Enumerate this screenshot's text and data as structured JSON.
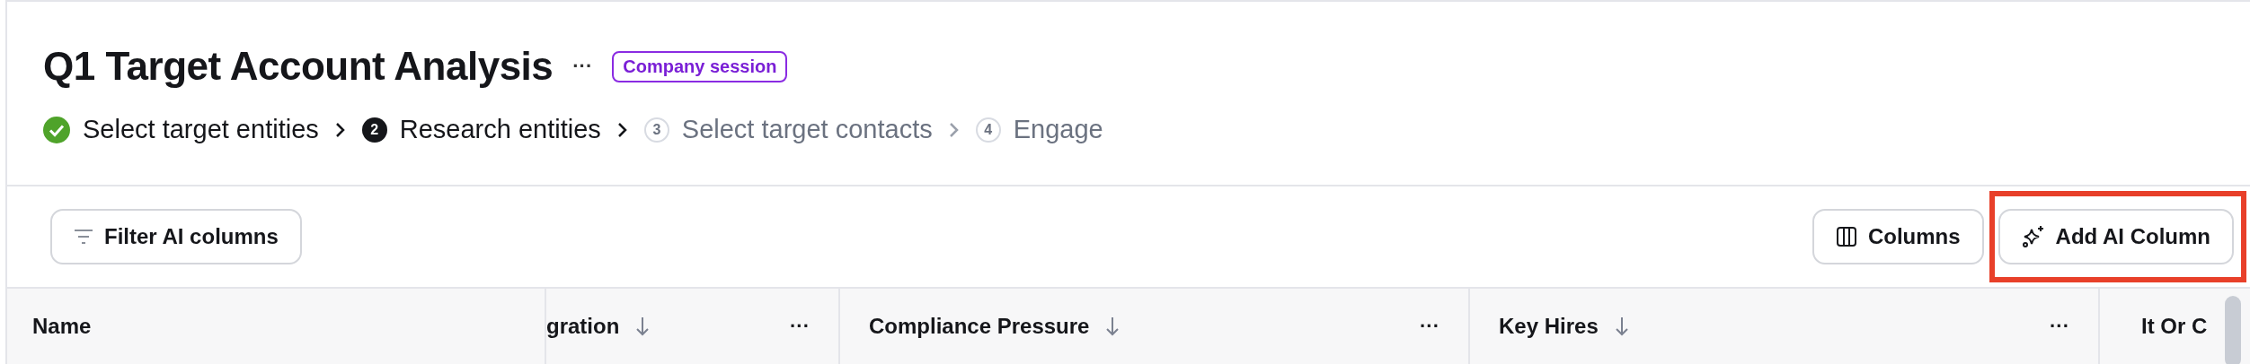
{
  "title": "Q1 Target Account Analysis",
  "more": "···",
  "badge": "Company session",
  "steps": [
    {
      "kind": "done",
      "label": "Select target entities"
    },
    {
      "kind": "current",
      "number": "2",
      "label": "Research entities"
    },
    {
      "kind": "upcoming",
      "number": "3",
      "label": "Select target contacts"
    },
    {
      "kind": "upcoming",
      "number": "4",
      "label": "Engage"
    }
  ],
  "toolbar": {
    "filter": {
      "label": "Filter AI columns"
    },
    "columns": {
      "label": "Columns"
    },
    "add": {
      "label": "Add AI Column",
      "highlighted": true
    }
  },
  "table": {
    "columns": [
      {
        "label": "Name",
        "sortable": false
      },
      {
        "label": "gration",
        "sortable": true,
        "menu": "···"
      },
      {
        "label": "Compliance Pressure",
        "sortable": true,
        "menu": "···"
      },
      {
        "label": "Key Hires",
        "sortable": true,
        "menu": "···"
      },
      {
        "label": "It Or C"
      }
    ]
  }
}
